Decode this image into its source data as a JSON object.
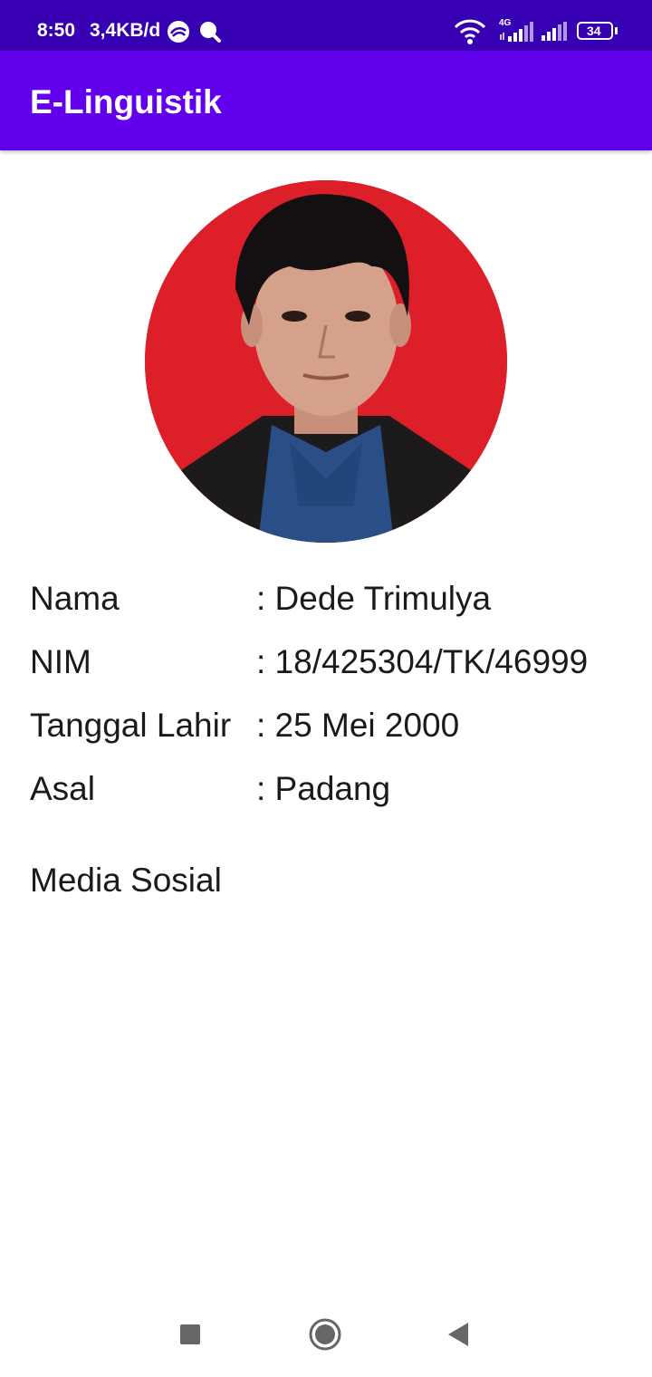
{
  "status_bar": {
    "time": "8:50",
    "network_speed": "3,4KB/d",
    "battery_level": "34",
    "network_type": "4G",
    "icons": [
      "vpn-icon",
      "search-icon",
      "wifi-icon",
      "signal-4g-icon",
      "signal-icon",
      "battery-icon"
    ]
  },
  "app_bar": {
    "title": "E-Linguistik"
  },
  "profile": {
    "avatar": "avatar-photo",
    "rows": [
      {
        "label": "Nama",
        "value": ": Dede Trimulya"
      },
      {
        "label": "NIM",
        "value": ": 18/425304/TK/46999"
      },
      {
        "label": "Tanggal Lahir",
        "value": ": 25 Mei 2000"
      },
      {
        "label": "Asal",
        "value": ": Padang"
      }
    ]
  },
  "social": {
    "title": "Media Sosial"
  },
  "nav_bar": {
    "buttons": [
      "recents-icon",
      "home-icon",
      "back-icon"
    ]
  },
  "colors": {
    "status_bar": "#3700b3",
    "app_bar": "#6200ee",
    "avatar_background": "#dc1f28",
    "text": "#1a1a1a"
  }
}
